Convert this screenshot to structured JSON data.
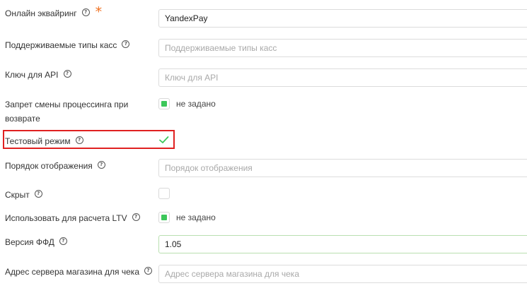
{
  "form": {
    "acquiring": {
      "label": "Онлайн эквайринг",
      "value": "YandexPay",
      "required_mark": "*"
    },
    "cash_types": {
      "label": "Поддерживаемые типы касс",
      "placeholder": "Поддерживаемые типы касс"
    },
    "api_key": {
      "label": "Ключ для API",
      "placeholder": "Ключ для API"
    },
    "processing_change": {
      "label_line1": "Запрет смены процессинга при",
      "label_line2": "возврате",
      "state_text": "не задано"
    },
    "test_mode": {
      "label": "Тестовый режим",
      "checked": true
    },
    "display_order": {
      "label": "Порядок отображения",
      "placeholder": "Порядок отображения"
    },
    "hidden": {
      "label": "Скрыт",
      "checked": false
    },
    "ltv": {
      "label": "Использовать для расчета LTV",
      "state_text": "не задано"
    },
    "ffd_version": {
      "label": "Версия ФФД",
      "value": "1.05"
    },
    "server_address": {
      "label": "Адрес сервера магазина для чека",
      "placeholder": "Адрес сервера магазина для чека"
    }
  },
  "help_icon_glyph": "?",
  "colors": {
    "accent_green": "#3cc75a",
    "required_orange": "#f07020",
    "highlight_red": "#e02020"
  }
}
